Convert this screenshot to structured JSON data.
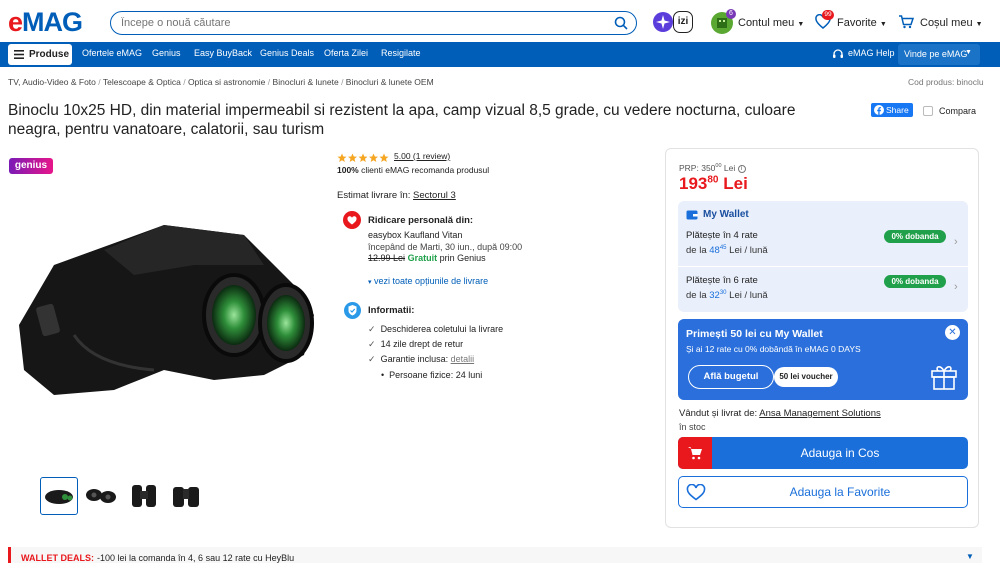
{
  "header": {
    "logo_text": "eMAG",
    "search": {
      "placeholder": "Începe o nouă căutare"
    },
    "izi_label": "izi",
    "account": {
      "label": "Contul meu",
      "badge": "6"
    },
    "favorites": {
      "label": "Favorite",
      "badge": "99"
    },
    "cart": {
      "label": "Coșul meu"
    }
  },
  "nav": {
    "products": "Produse",
    "items": [
      "Ofertele eMAG",
      "Genius",
      "Easy BuyBack",
      "Genius Deals",
      "Oferta Zilei",
      "Resigilate"
    ],
    "help": "eMAG Help",
    "sell": "Vinde pe eMAG"
  },
  "breadcrumb": [
    "TV, Audio-Video & Foto",
    "Telescoape & Optica",
    "Optica si astronomie",
    "Binocluri & lunete",
    "Binocluri & lunete OEM"
  ],
  "product_code": "Cod produs: binoclu",
  "title": "Binoclu 10x25 HD, din material impermeabil si rezistent la apa, camp vizual 8,5 grade, cu vedere nocturna, culoare neagra, pentru vanatoare, calatorii, sau turism",
  "actions": {
    "share": "Share",
    "compare": "Compara"
  },
  "genius_badge": "genius",
  "rating": {
    "value": 5,
    "text": "5.00 (1 review)",
    "recommend_pct": "100%",
    "recommend_text": "clienti eMAG recomanda produsul"
  },
  "delivery": {
    "estimate_label": "Estimat livrare în:",
    "sector": "Sectorul 3",
    "pickup_title": "Ridicare personală din:",
    "pickup_place": "easybox Kaufland Vitan",
    "pickup_time": "începând de Marti, 30 iun., după 09:00",
    "old_price": "12.99 Lei",
    "free": "Gratuit",
    "free_suffix": "prin Genius",
    "all_options": "vezi toate opțiunile de livrare"
  },
  "info": {
    "title": "Informatii:",
    "items": [
      "Deschiderea coletului la livrare",
      "14 zile drept de retur"
    ],
    "warranty_label": "Garantie inclusa:",
    "warranty_link": "detalii",
    "warranty_sub": "Persoane fizice: 24 luni"
  },
  "price": {
    "prp_label": "PRP:",
    "prp_int": "350",
    "prp_dec": "00",
    "prp_cur": "Lei",
    "int": "193",
    "dec": "80",
    "currency": "Lei"
  },
  "wallet": {
    "title": "My Wallet",
    "plans": [
      {
        "title": "Plătește în 4 rate",
        "prefix": "de la",
        "int": "48",
        "dec": "45",
        "suffix": "Lei / lună",
        "badge": "0% dobanda"
      },
      {
        "title": "Plătește în 6 rate",
        "prefix": "de la",
        "int": "32",
        "dec": "30",
        "suffix": "Lei / lună",
        "badge": "0% dobanda"
      }
    ]
  },
  "promo": {
    "title": "Primești 50 lei cu My Wallet",
    "subtitle": "Și ai 12 rate cu 0% dobândă în eMAG 0 DAYS",
    "button": "Află bugetul",
    "voucher": "50 lei voucher"
  },
  "seller": {
    "label": "Vândut și livrat de:",
    "name": "Ansa Management Solutions",
    "stock": "în stoc"
  },
  "buttons": {
    "add_cart": "Adauga in Cos",
    "add_fav": "Adauga la Favorite"
  },
  "wallet_deals": {
    "label": "WALLET DEALS:",
    "text": "-100 lei la comanda în 4, 6 sau 12 rate cu HeyBlu"
  },
  "colors": {
    "brand_blue": "#005eb8",
    "brand_red": "#e8181d",
    "price_red": "#e8181d",
    "green": "#20a04a"
  }
}
